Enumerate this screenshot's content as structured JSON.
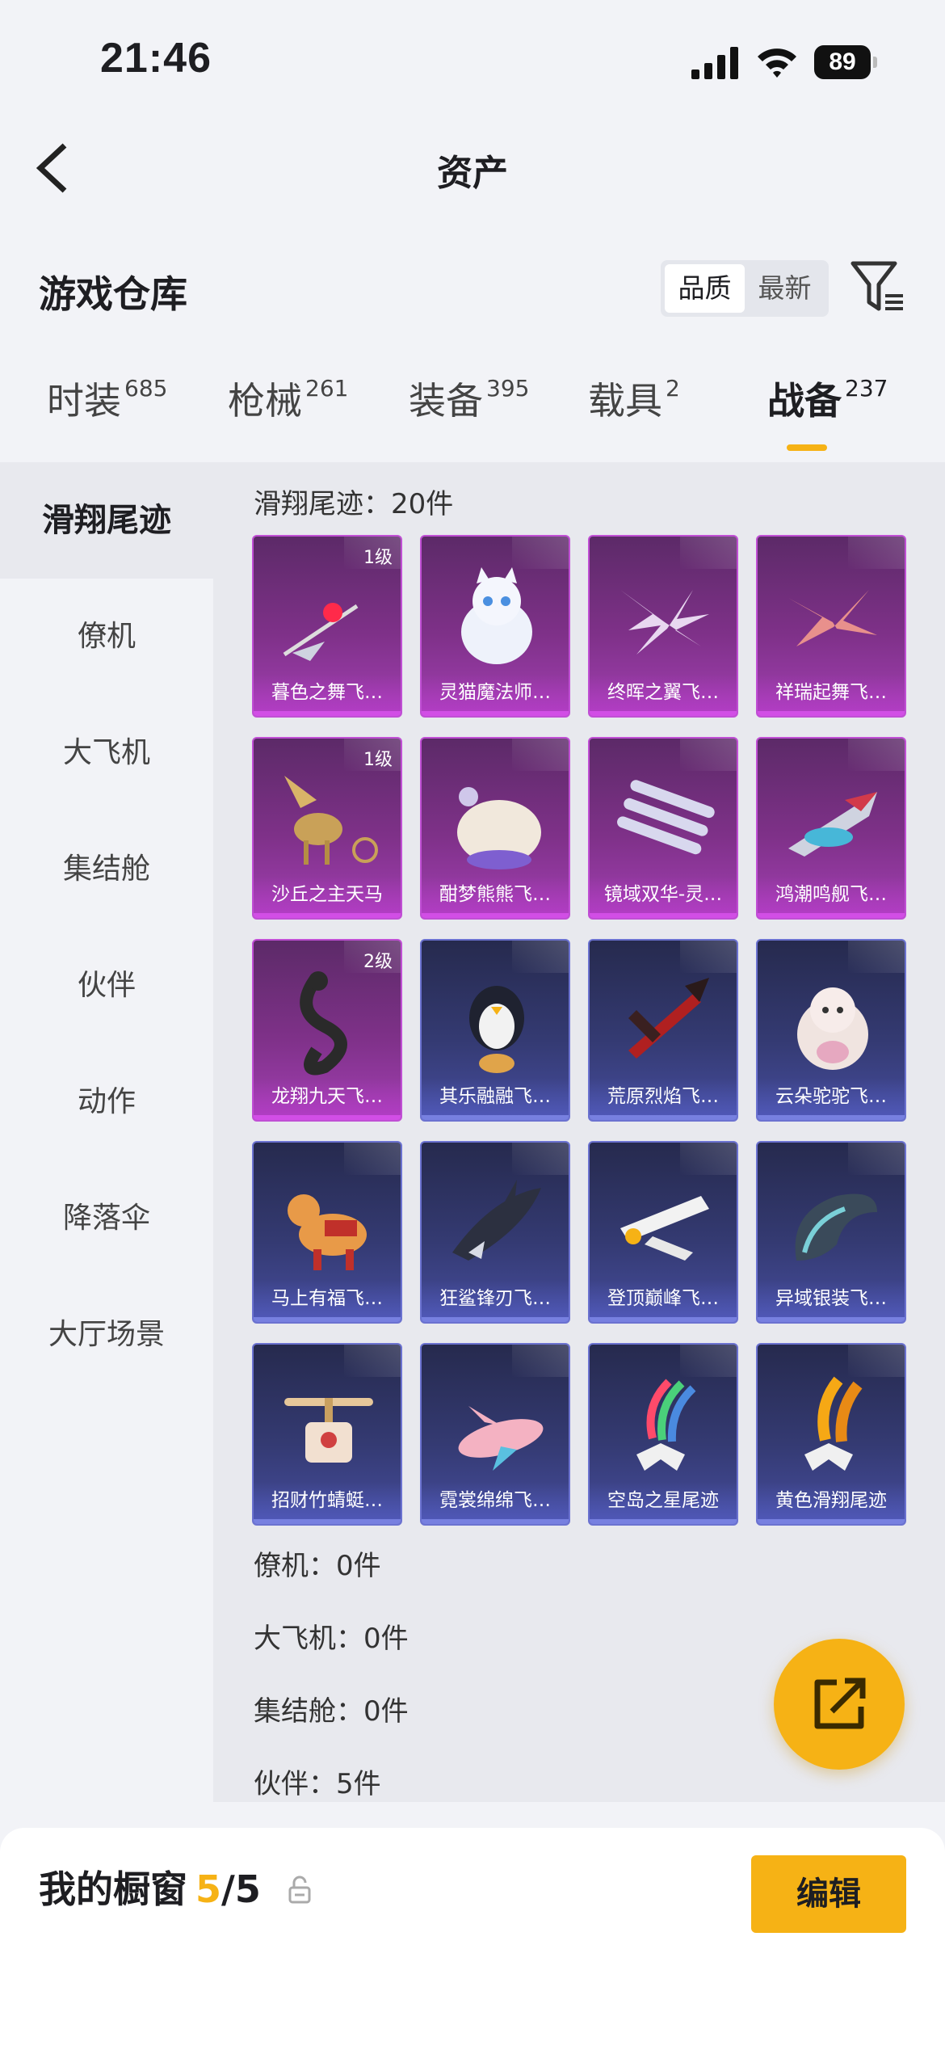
{
  "status_bar": {
    "time": "21:46",
    "battery": "89"
  },
  "header": {
    "title": "资产"
  },
  "section": {
    "title": "游戏仓库",
    "sort_options": [
      "品质",
      "最新"
    ]
  },
  "tabs": [
    {
      "label": "时装",
      "count": "685"
    },
    {
      "label": "枪械",
      "count": "261"
    },
    {
      "label": "装备",
      "count": "395"
    },
    {
      "label": "载具",
      "count": "2"
    },
    {
      "label": "战备",
      "count": "237"
    }
  ],
  "sidebar": [
    "滑翔尾迹",
    "僚机",
    "大飞机",
    "集结舱",
    "伙伴",
    "动作",
    "降落伞",
    "大厅场景"
  ],
  "content": {
    "group_header": "滑翔尾迹：20件",
    "items": [
      {
        "name": "暮色之舞飞…",
        "level": "1级",
        "rarity": "purple",
        "icon": "flight-trail-red-icon"
      },
      {
        "name": "灵猫魔法师…",
        "level": "",
        "rarity": "purple",
        "icon": "magic-cat-icon"
      },
      {
        "name": "终晖之翼飞…",
        "level": "",
        "rarity": "purple",
        "icon": "feather-wings-icon"
      },
      {
        "name": "祥瑞起舞飞…",
        "level": "",
        "rarity": "purple",
        "icon": "red-wings-icon"
      },
      {
        "name": "沙丘之主天马",
        "level": "1级",
        "rarity": "purple",
        "icon": "golden-pegasus-icon"
      },
      {
        "name": "酣梦熊熊飞…",
        "level": "",
        "rarity": "purple",
        "icon": "sleepy-bear-icon"
      },
      {
        "name": "镜域双华-灵…",
        "level": "",
        "rarity": "purple",
        "icon": "crystal-shards-icon"
      },
      {
        "name": "鸿潮鸣舰飞…",
        "level": "",
        "rarity": "purple",
        "icon": "warship-glider-icon"
      },
      {
        "name": "龙翔九天飞…",
        "level": "2级",
        "rarity": "purple",
        "icon": "black-dragon-icon"
      },
      {
        "name": "其乐融融飞…",
        "level": "",
        "rarity": "blue",
        "icon": "penguin-icon"
      },
      {
        "name": "荒原烈焰飞…",
        "level": "",
        "rarity": "blue",
        "icon": "flame-glider-icon"
      },
      {
        "name": "云朵驼驼飞…",
        "level": "",
        "rarity": "blue",
        "icon": "alpaca-icon"
      },
      {
        "name": "马上有福飞…",
        "level": "",
        "rarity": "blue",
        "icon": "lucky-horse-icon"
      },
      {
        "name": "狂鲨锋刃飞…",
        "level": "",
        "rarity": "blue",
        "icon": "shark-glider-icon"
      },
      {
        "name": "登顶巅峰飞…",
        "level": "",
        "rarity": "blue",
        "icon": "white-jet-icon"
      },
      {
        "name": "异域银装飞…",
        "level": "",
        "rarity": "blue",
        "icon": "silver-wings-icon"
      },
      {
        "name": "招财竹蜻蜓…",
        "level": "",
        "rarity": "blue",
        "icon": "bamboo-copter-icon"
      },
      {
        "name": "霓裳绵绵飞…",
        "level": "",
        "rarity": "blue",
        "icon": "pink-plane-icon"
      },
      {
        "name": "空岛之星尾迹",
        "level": "",
        "rarity": "blue",
        "icon": "rainbow-smoke-skydiver-icon"
      },
      {
        "name": "黄色滑翔尾迹",
        "level": "",
        "rarity": "blue",
        "icon": "yellow-smoke-skydiver-icon"
      }
    ],
    "other_groups": [
      "僚机：0件",
      "大飞机：0件",
      "集结舱：0件",
      "伙伴：5件"
    ]
  },
  "bottom": {
    "showcase_label": "我的橱窗",
    "showcase_current": "5",
    "showcase_total": "/5",
    "edit_label": "编辑"
  },
  "colors": {
    "accent": "#f6b215",
    "purple_rarity": "#a23fb2",
    "blue_rarity": "#454c9c"
  }
}
